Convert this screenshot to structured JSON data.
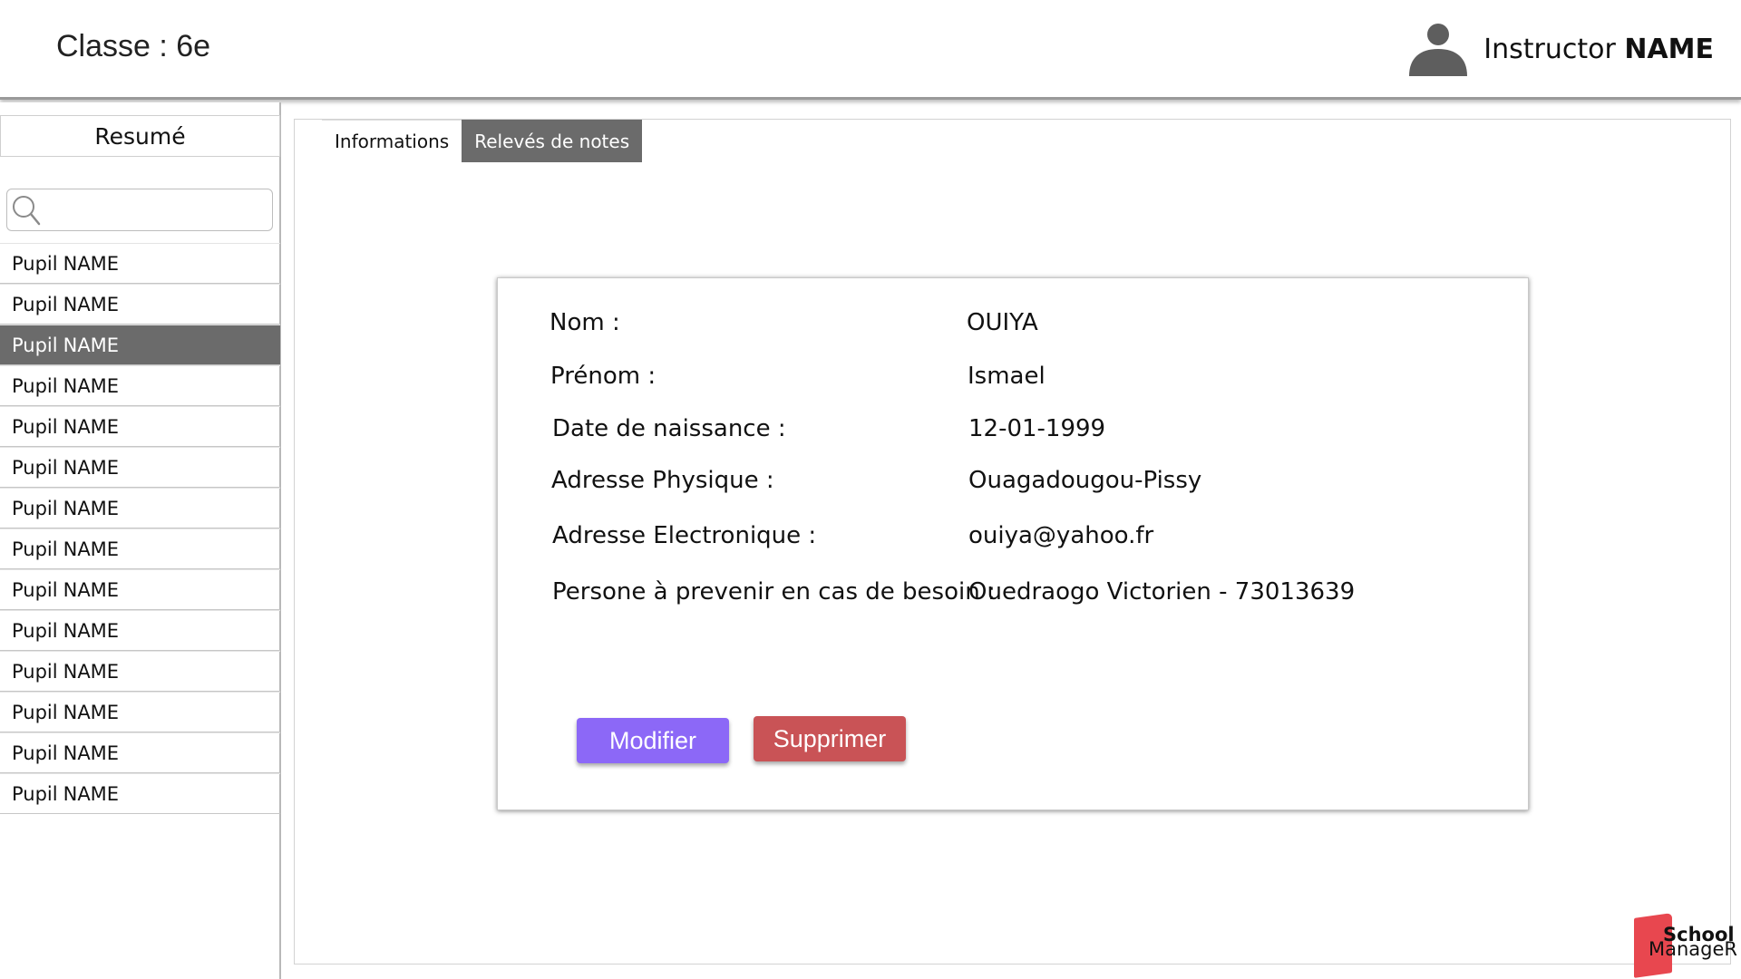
{
  "header": {
    "class_label": "Classe : 6e",
    "instructor_role": "Instructor",
    "instructor_name": "NAME"
  },
  "sidebar": {
    "title": "Resumé",
    "search": {
      "placeholder": "",
      "value": ""
    },
    "selected_index": 2,
    "pupils": [
      {
        "first": "Pupil",
        "last": "NAME"
      },
      {
        "first": "Pupil",
        "last": "NAME"
      },
      {
        "first": "Pupil",
        "last": "NAME"
      },
      {
        "first": "Pupil",
        "last": "NAME"
      },
      {
        "first": "Pupil",
        "last": "NAME"
      },
      {
        "first": "Pupil",
        "last": "NAME"
      },
      {
        "first": "Pupil",
        "last": "NAME"
      },
      {
        "first": "Pupil",
        "last": "NAME"
      },
      {
        "first": "Pupil",
        "last": "NAME"
      },
      {
        "first": "Pupil",
        "last": "NAME"
      },
      {
        "first": "Pupil",
        "last": "NAME"
      },
      {
        "first": "Pupil",
        "last": "NAME"
      },
      {
        "first": "Pupil",
        "last": "NAME"
      },
      {
        "first": "Pupil",
        "last": "NAME"
      }
    ]
  },
  "main": {
    "tabs": [
      {
        "label": "Informations",
        "active": false
      },
      {
        "label": "Relevés de notes",
        "active": true
      }
    ],
    "student": {
      "fields": [
        {
          "label": "Nom :",
          "value": "OUIYA"
        },
        {
          "label": "Prénom :",
          "value": "Ismael"
        },
        {
          "label": "Date de naissance :",
          "value": "12-01-1999"
        },
        {
          "label": "Adresse Physique :",
          "value": "Ouagadougou-Pissy"
        },
        {
          "label": "Adresse Electronique :",
          "value": "ouiya@yahoo.fr"
        },
        {
          "label": "Persone à prevenir en cas de besoin :",
          "value": "Ouedraogo Victorien - 73013639"
        }
      ],
      "edit_label": "Modifier",
      "delete_label": "Supprimer"
    }
  },
  "logo": {
    "line1": "School",
    "line2": "ManageR"
  },
  "colors": {
    "selected_row": "#6b6b6b",
    "edit_button": "#8c68f7",
    "delete_button": "#c95356",
    "logo_red": "#e8474f"
  },
  "icons": {
    "avatar": "user-avatar-icon",
    "search": "search-icon"
  }
}
